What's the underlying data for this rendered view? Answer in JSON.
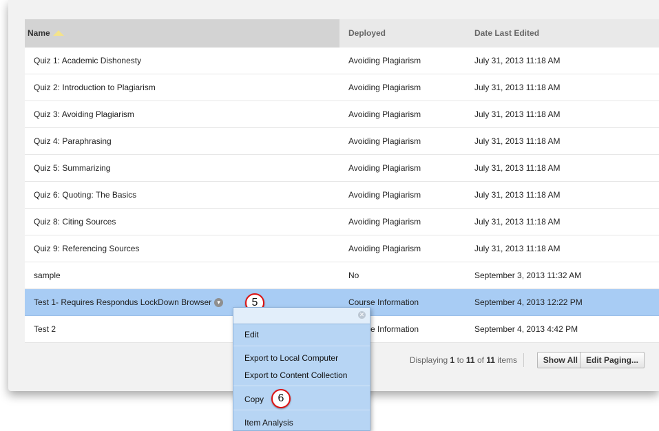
{
  "table": {
    "headers": {
      "name": "Name",
      "deployed": "Deployed",
      "date": "Date Last Edited"
    },
    "rows": [
      {
        "name": "Quiz 1: Academic Dishonesty",
        "deployed": "Avoiding Plagiarism",
        "date": "July 31, 2013 11:18 AM"
      },
      {
        "name": "Quiz 2: Introduction to Plagiarism",
        "deployed": "Avoiding Plagiarism",
        "date": "July 31, 2013 11:18 AM"
      },
      {
        "name": "Quiz 3: Avoiding Plagiarism",
        "deployed": "Avoiding Plagiarism",
        "date": "July 31, 2013 11:18 AM"
      },
      {
        "name": "Quiz 4: Paraphrasing",
        "deployed": "Avoiding Plagiarism",
        "date": "July 31, 2013 11:18 AM"
      },
      {
        "name": "Quiz 5: Summarizing",
        "deployed": "Avoiding Plagiarism",
        "date": "July 31, 2013 11:18 AM"
      },
      {
        "name": "Quiz 6: Quoting: The Basics",
        "deployed": "Avoiding Plagiarism",
        "date": "July 31, 2013 11:18 AM"
      },
      {
        "name": "Quiz 8: Citing Sources",
        "deployed": "Avoiding Plagiarism",
        "date": "July 31, 2013 11:18 AM"
      },
      {
        "name": "Quiz 9: Referencing Sources",
        "deployed": "Avoiding Plagiarism",
        "date": "July 31, 2013 11:18 AM"
      },
      {
        "name": "sample",
        "deployed": "No",
        "date": "September 3, 2013 11:32 AM"
      },
      {
        "name": "Test 1- Requires Respondus LockDown Browser",
        "deployed": "Course Information",
        "date": "September 4, 2013 12:22 PM"
      },
      {
        "name": "Test 2",
        "deployed": "Course Information",
        "date": "September 4, 2013 4:42 PM"
      }
    ]
  },
  "callouts": {
    "five": "5",
    "six": "6"
  },
  "paging": {
    "prefix": "Displaying ",
    "from": "1",
    "to_word": " to ",
    "to": "11",
    "of_word": " of ",
    "total": "11",
    "suffix": " items",
    "show_all": "Show All",
    "edit_paging": "Edit Paging..."
  },
  "context_menu": {
    "items": [
      "Edit",
      "Export to Local Computer",
      "Export to Content Collection",
      "Copy",
      "Item Analysis"
    ]
  },
  "colors": {
    "selected_row": "#a8ccf4",
    "menu_bg": "#b7d5f4",
    "callout_border": "#dd1111"
  },
  "icons": {
    "sort": "sort-ascending-icon",
    "row_menu": "chevron-down-icon",
    "menu_close": "close-icon"
  }
}
